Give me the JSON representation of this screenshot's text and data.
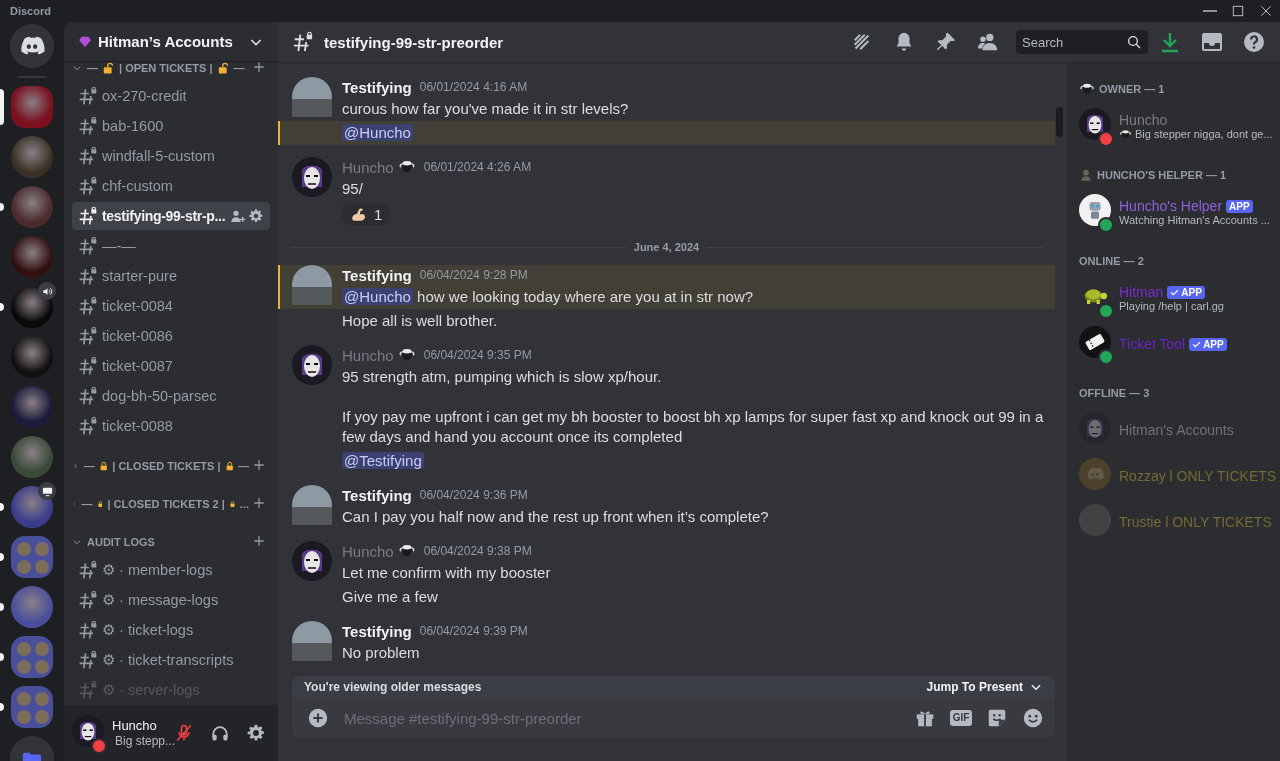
{
  "app_title": "Discord",
  "servers": [
    {
      "kind": "home",
      "selected": false,
      "unread": false,
      "voice": false,
      "screen": false
    },
    {
      "kind": "server",
      "selected": true,
      "unread": false,
      "voice": false,
      "screen": false
    },
    {
      "kind": "server",
      "selected": false,
      "unread": false,
      "voice": false,
      "screen": false
    },
    {
      "kind": "server",
      "selected": false,
      "unread": true,
      "voice": false,
      "screen": false
    },
    {
      "kind": "server",
      "selected": false,
      "unread": false,
      "voice": false,
      "screen": false
    },
    {
      "kind": "server",
      "selected": false,
      "unread": true,
      "voice": true,
      "screen": false
    },
    {
      "kind": "server",
      "selected": false,
      "unread": false,
      "voice": false,
      "screen": false
    },
    {
      "kind": "server",
      "selected": false,
      "unread": false,
      "voice": false,
      "screen": false
    },
    {
      "kind": "server",
      "selected": false,
      "unread": false,
      "voice": false,
      "screen": false
    },
    {
      "kind": "server",
      "selected": false,
      "unread": true,
      "voice": false,
      "screen": true
    },
    {
      "kind": "folder",
      "selected": false,
      "unread": true,
      "voice": false,
      "screen": false
    },
    {
      "kind": "server",
      "selected": false,
      "unread": true,
      "voice": false,
      "screen": false
    },
    {
      "kind": "folder",
      "selected": false,
      "unread": true,
      "voice": false,
      "screen": false
    },
    {
      "kind": "folder",
      "selected": false,
      "unread": true,
      "voice": false,
      "screen": false
    },
    {
      "kind": "files",
      "selected": false,
      "unread": false,
      "voice": false,
      "screen": false
    }
  ],
  "server_header": {
    "name": "Hitman’s Accounts"
  },
  "channel_sections": [
    {
      "kind": "unlocked",
      "lead": "—",
      "label": "| OPEN TICKETS |",
      "trail": "—",
      "expanded": true,
      "channels": [
        {
          "name": "ox-270-credit",
          "selected": false,
          "muted": false
        },
        {
          "name": "bab-1600",
          "selected": false,
          "muted": false
        },
        {
          "name": "windfall-5-custom",
          "selected": false,
          "muted": false
        },
        {
          "name": "chf-custom",
          "selected": false,
          "muted": false
        },
        {
          "name": "testifying-99-str-p...",
          "selected": true,
          "muted": false
        },
        {
          "name": "—-—",
          "selected": false,
          "muted": false
        },
        {
          "name": "starter-pure",
          "selected": false,
          "muted": false
        },
        {
          "name": "ticket-0084",
          "selected": false,
          "muted": false
        },
        {
          "name": "ticket-0086",
          "selected": false,
          "muted": false
        },
        {
          "name": "ticket-0087",
          "selected": false,
          "muted": false
        },
        {
          "name": "dog-bh-50-parsec",
          "selected": false,
          "muted": false
        },
        {
          "name": "ticket-0088",
          "selected": false,
          "muted": false
        }
      ]
    },
    {
      "kind": "locked",
      "lead": "—",
      "label": "| CLOSED TICKETS |",
      "trail": "—",
      "expanded": false
    },
    {
      "kind": "locked",
      "lead": "—",
      "label": "| CLOSED TICKETS 2 |",
      "trail": "...",
      "expanded": false
    },
    {
      "kind": "plain",
      "label": "AUDIT LOGS",
      "expanded": true,
      "channels": [
        {
          "name": "⚙ · member-logs",
          "selected": false,
          "muted": false
        },
        {
          "name": "⚙ · message-logs",
          "selected": false,
          "muted": false
        },
        {
          "name": "⚙ · ticket-logs",
          "selected": false,
          "muted": false
        },
        {
          "name": "⚙ · ticket-transcripts",
          "selected": false,
          "muted": false
        },
        {
          "name": "⚙ · server-logs",
          "selected": false,
          "muted": true
        }
      ]
    }
  ],
  "user_panel": {
    "name": "Huncho",
    "status": "Big stepp...",
    "mic_muted": true
  },
  "channel_header": {
    "title": "testifying-99-str-preorder",
    "search_placeholder": "Search"
  },
  "messages": [
    {
      "kind": "message",
      "author": "Testifying",
      "color": "#f2f3f5",
      "role_icon": false,
      "time": "06/01/2024 4:16 AM",
      "lines": [
        {
          "text": "curous how far you've made it in str levels?",
          "highlighted": false
        },
        {
          "mention": "@Huncho",
          "highlighted": true
        }
      ]
    },
    {
      "kind": "message",
      "author": "Huncho",
      "color": "#7a7c84",
      "role_icon": true,
      "time": "06/01/2024 4:26 AM",
      "lines": [
        {
          "text": "95/",
          "highlighted": false
        }
      ],
      "reaction": {
        "count": "1"
      }
    },
    {
      "kind": "divider",
      "text": "June 4, 2024"
    },
    {
      "kind": "message",
      "author": "Testifying",
      "color": "#f2f3f5",
      "role_icon": false,
      "time": "06/04/2024 9:28 PM",
      "lines": [
        {
          "mention": "@Huncho",
          "text": "how we looking today where are you at in str now?",
          "highlighted": true
        },
        {
          "text": "Hope all is well brother.",
          "highlighted": false
        }
      ]
    },
    {
      "kind": "message",
      "author": "Huncho",
      "color": "#7a7c84",
      "role_icon": true,
      "time": "06/04/2024 9:35 PM",
      "lines": [
        {
          "text": "95 strength atm, pumping which is slow xp/hour.\n\nIf yoy pay me upfront i can get my bh booster to boost bh xp lamps for super fast xp and knock out 99 in a few days and hand you account once its completed",
          "highlighted": false
        },
        {
          "mention": "@Testifying",
          "highlighted": false
        }
      ]
    },
    {
      "kind": "message",
      "author": "Testifying",
      "color": "#f2f3f5",
      "role_icon": false,
      "time": "06/04/2024 9:36 PM",
      "lines": [
        {
          "text": "Can I pay you half now and the rest up front when it’s complete?",
          "highlighted": false
        }
      ]
    },
    {
      "kind": "message",
      "author": "Huncho",
      "color": "#7a7c84",
      "role_icon": true,
      "time": "06/04/2024 9:38 PM",
      "lines": [
        {
          "text": "Let me confirm with my booster",
          "highlighted": false
        },
        {
          "text": "Give me a few",
          "highlighted": false
        }
      ]
    },
    {
      "kind": "message",
      "author": "Testifying",
      "color": "#f2f3f5",
      "role_icon": false,
      "time": "06/04/2024 9:39 PM",
      "lines": [
        {
          "text": "No problem",
          "highlighted": false
        }
      ]
    }
  ],
  "older_bar": {
    "text": "You're viewing older messages",
    "action": "Jump To Present"
  },
  "composer": {
    "placeholder": "Message #testifying-99-str-preorder",
    "gif_label": "GIF"
  },
  "member_groups": [
    {
      "title": "OWNER — 1",
      "members": [
        {
          "kind": "dnd",
          "name": "Huncho",
          "color": "#7a7c84",
          "status": "Big stepper nigga, dont ge...",
          "status_icon": true
        }
      ]
    },
    {
      "title": "HUNCHO'S HELPER — 1",
      "members": [
        {
          "kind": "online",
          "name": "Huncho's Helper",
          "color": "#9060e0",
          "app": "APP",
          "verified": false,
          "status": "Watching Hitman's Accounts ...",
          "status_icon": false
        }
      ]
    },
    {
      "title": "ONLINE — 2",
      "members": [
        {
          "kind": "online",
          "name": "Hitman",
          "color": "#7a2bd0",
          "app": "APP",
          "verified": true,
          "status": "Playing /help | carl.gg",
          "status_icon": false
        },
        {
          "kind": "online",
          "name": "Ticket Tool",
          "color": "#6a22c0",
          "app": "APP",
          "verified": true
        }
      ]
    },
    {
      "title": "OFFLINE — 3",
      "members": [
        {
          "kind": "offline",
          "name": "Hitman's Accounts",
          "color": "#70727a"
        },
        {
          "kind": "offline",
          "name": "Rozzay l ONLY TICKETS",
          "color": "#756a32"
        },
        {
          "kind": "offline",
          "name": "Trustie l ONLY TICKETS",
          "color": "#756a32"
        }
      ]
    }
  ]
}
